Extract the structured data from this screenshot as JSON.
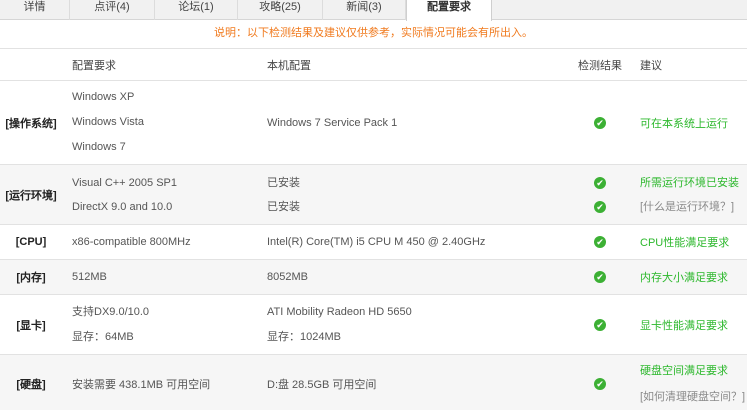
{
  "tabs": [
    {
      "label": "详情"
    },
    {
      "label": "点评(4)"
    },
    {
      "label": "论坛(1)"
    },
    {
      "label": "攻略(25)"
    },
    {
      "label": "新闻(3)"
    },
    {
      "label": "配置要求"
    }
  ],
  "notice": "说明：以下检测结果及建议仅供参考，实际情况可能会有所出入。",
  "headers": {
    "req": "配置要求",
    "local": "本机配置",
    "result": "检测结果",
    "advice": "建议"
  },
  "colors": {
    "advice_ok": "#2db82d",
    "notice": "#f07a1e",
    "check": "#3cb034"
  },
  "icons": {
    "check": "check-circle-icon"
  },
  "rows": {
    "os": {
      "cat": "[操作系统]",
      "req": [
        "Windows XP",
        "Windows Vista",
        "Windows 7"
      ],
      "local": "Windows 7 Service Pack 1",
      "advice": "可在本系统上运行"
    },
    "runtime": {
      "cat": "[运行环境]",
      "req": [
        "Visual C++ 2005 SP1",
        "DirectX 9.0 and 10.0"
      ],
      "local": [
        "已安装",
        "已安装"
      ],
      "advice": [
        "所需运行环境已安装",
        "[什么是运行环境？]"
      ]
    },
    "cpu": {
      "cat": "[CPU]",
      "req": "x86-compatible 800MHz",
      "local": "Intel(R) Core(TM) i5 CPU M 450 @ 2.40GHz",
      "advice": "CPU性能满足要求"
    },
    "mem": {
      "cat": "[内存]",
      "req": "512MB",
      "local": "8052MB",
      "advice": "内存大小满足要求"
    },
    "gpu": {
      "cat": "[显卡]",
      "req": [
        "支持DX9.0/10.0",
        "显存：64MB"
      ],
      "local": [
        "ATI Mobility Radeon HD 5650",
        "显存：1024MB"
      ],
      "advice": "显卡性能满足要求"
    },
    "disk": {
      "cat": "[硬盘]",
      "req": "安装需要  438.1MB 可用空间",
      "local": "D:盘  28.5GB 可用空间",
      "advice": [
        "硬盘空间满足要求",
        "[如何清理硬盘空间？]"
      ]
    }
  }
}
